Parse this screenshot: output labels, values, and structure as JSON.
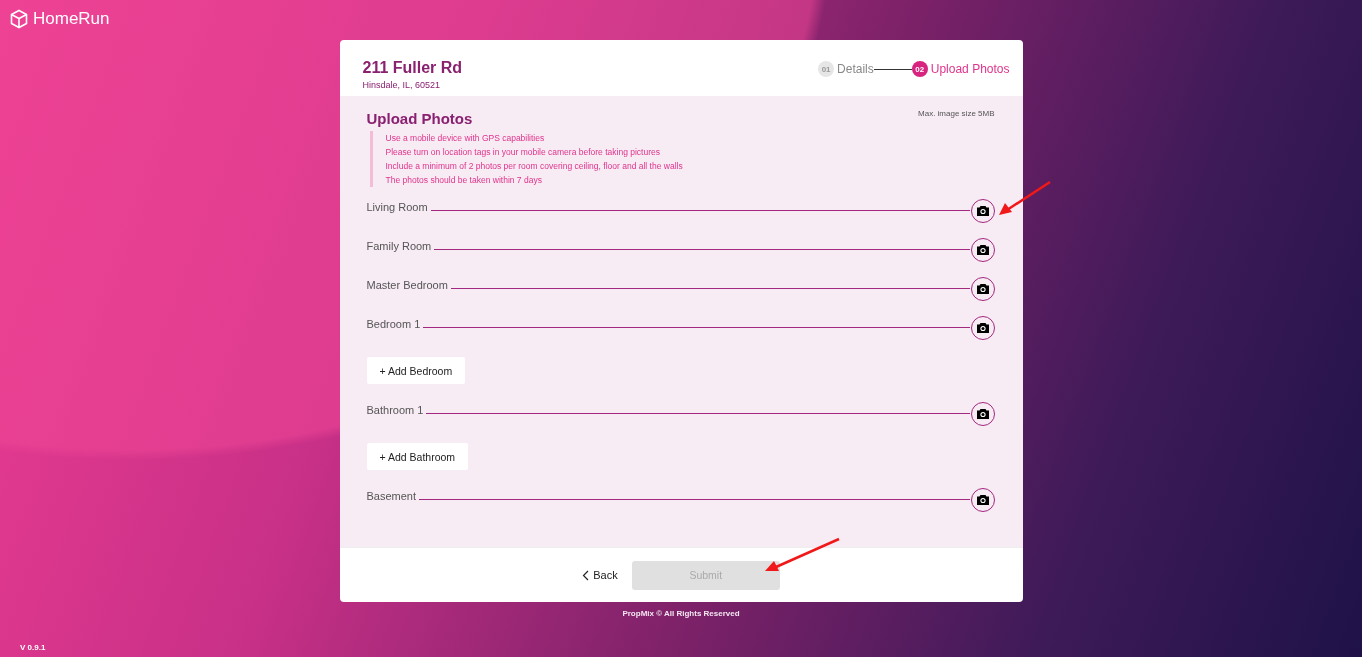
{
  "brand": {
    "name": "HomeRun"
  },
  "property": {
    "address": "211 Fuller Rd",
    "city": "Hinsdale, IL, 60521"
  },
  "steps": [
    {
      "number": "01",
      "label": "Details",
      "selected": false
    },
    {
      "number": "02",
      "label": "Upload Photos",
      "selected": true
    }
  ],
  "section": {
    "title": "Upload Photos",
    "max_size": "Max. image size 5MB",
    "instructions": [
      "Use a mobile device with GPS capabilities",
      "Please turn on location tags in your mobile camera before taking pictures",
      "Include a minimum of 2 photos per room covering ceiling, floor and all the walls",
      "The photos should be taken within 7 days"
    ]
  },
  "rows": [
    {
      "kind": "room",
      "label": "Living Room"
    },
    {
      "kind": "room",
      "label": "Family Room"
    },
    {
      "kind": "room",
      "label": "Master Bedroom"
    },
    {
      "kind": "room",
      "label": "Bedroom 1"
    },
    {
      "kind": "add",
      "label": "+ Add Bedroom"
    },
    {
      "kind": "room",
      "label": "Bathroom 1"
    },
    {
      "kind": "add",
      "label": "+ Add Bathroom"
    },
    {
      "kind": "room",
      "label": "Basement"
    }
  ],
  "footer": {
    "back": "Back",
    "submit": {
      "label": "Submit",
      "disabled": true
    }
  },
  "copyright": "PropMix © All Rights Reserved",
  "version": "V 0.9.1"
}
